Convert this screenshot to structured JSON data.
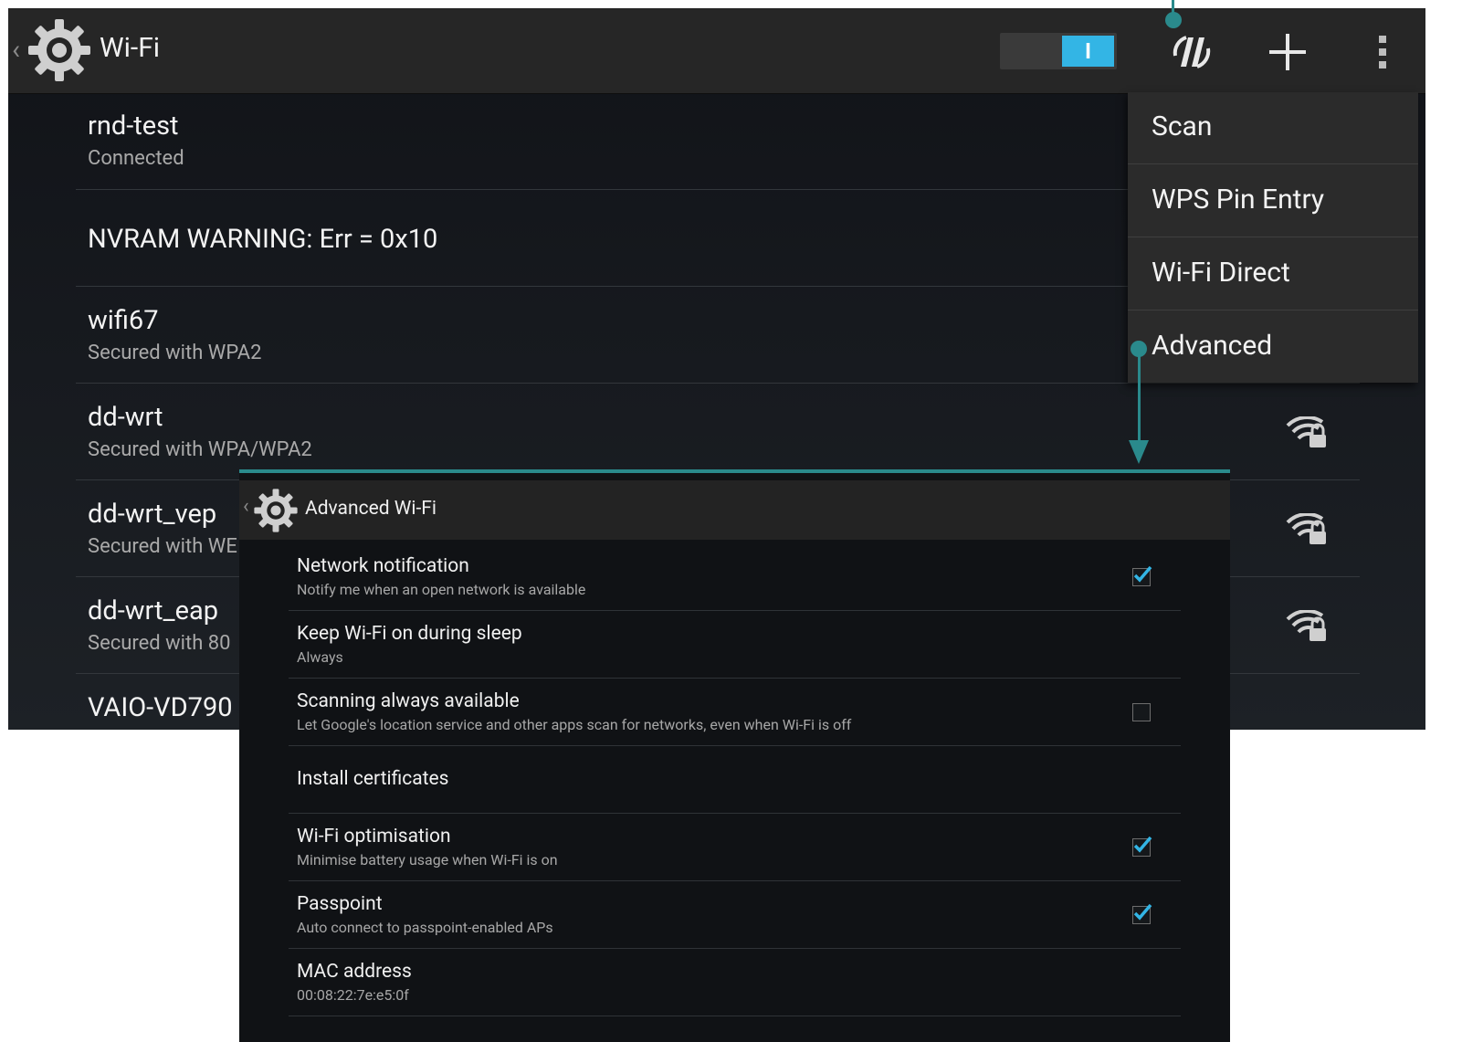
{
  "main": {
    "title": "Wi-Fi",
    "toggle_label": "I",
    "networks": [
      {
        "name": "rnd-test",
        "status": "Connected"
      },
      {
        "name": "NVRAM WARNING: Err = 0x10",
        "status": ""
      },
      {
        "name": "wifi67",
        "status": "Secured with WPA2"
      },
      {
        "name": "dd-wrt",
        "status": "Secured with WPA/WPA2"
      },
      {
        "name": "dd-wrt_vep",
        "status": "Secured with WE"
      },
      {
        "name": "dd-wrt_eap",
        "status": "Secured with 80"
      },
      {
        "name": "VAIO-VD790",
        "status": ""
      }
    ],
    "icons": {
      "scan": "wifi-scan-icon",
      "add": "add-icon",
      "more": "overflow-menu-icon",
      "signal": "wifi-lock-signal-icon"
    },
    "overflow_menu": [
      "Scan",
      "WPS Pin Entry",
      "Wi-Fi Direct",
      "Advanced"
    ]
  },
  "advanced": {
    "title": "Advanced Wi-Fi",
    "prefs": [
      {
        "title": "Network notification",
        "summary": "Notify me when an open network is available",
        "checked": true
      },
      {
        "title": "Keep Wi-Fi on during sleep",
        "summary": "Always",
        "checked": null
      },
      {
        "title": "Scanning always available",
        "summary": "Let Google's location service and other apps scan for networks, even when Wi-Fi is off",
        "checked": false
      },
      {
        "title": "Install certificates",
        "summary": "",
        "checked": null
      },
      {
        "title": "Wi-Fi optimisation",
        "summary": "Minimise battery usage when Wi-Fi is on",
        "checked": true
      },
      {
        "title": "Passpoint",
        "summary": "Auto connect to passpoint-enabled APs",
        "checked": true
      },
      {
        "title": "MAC address",
        "summary": "00:08:22:7e:e5:0f",
        "checked": null
      }
    ]
  },
  "colors": {
    "accent": "#33b5e5",
    "callout": "#2a8a8c",
    "background": "#111318",
    "actionbar": "#262626"
  }
}
